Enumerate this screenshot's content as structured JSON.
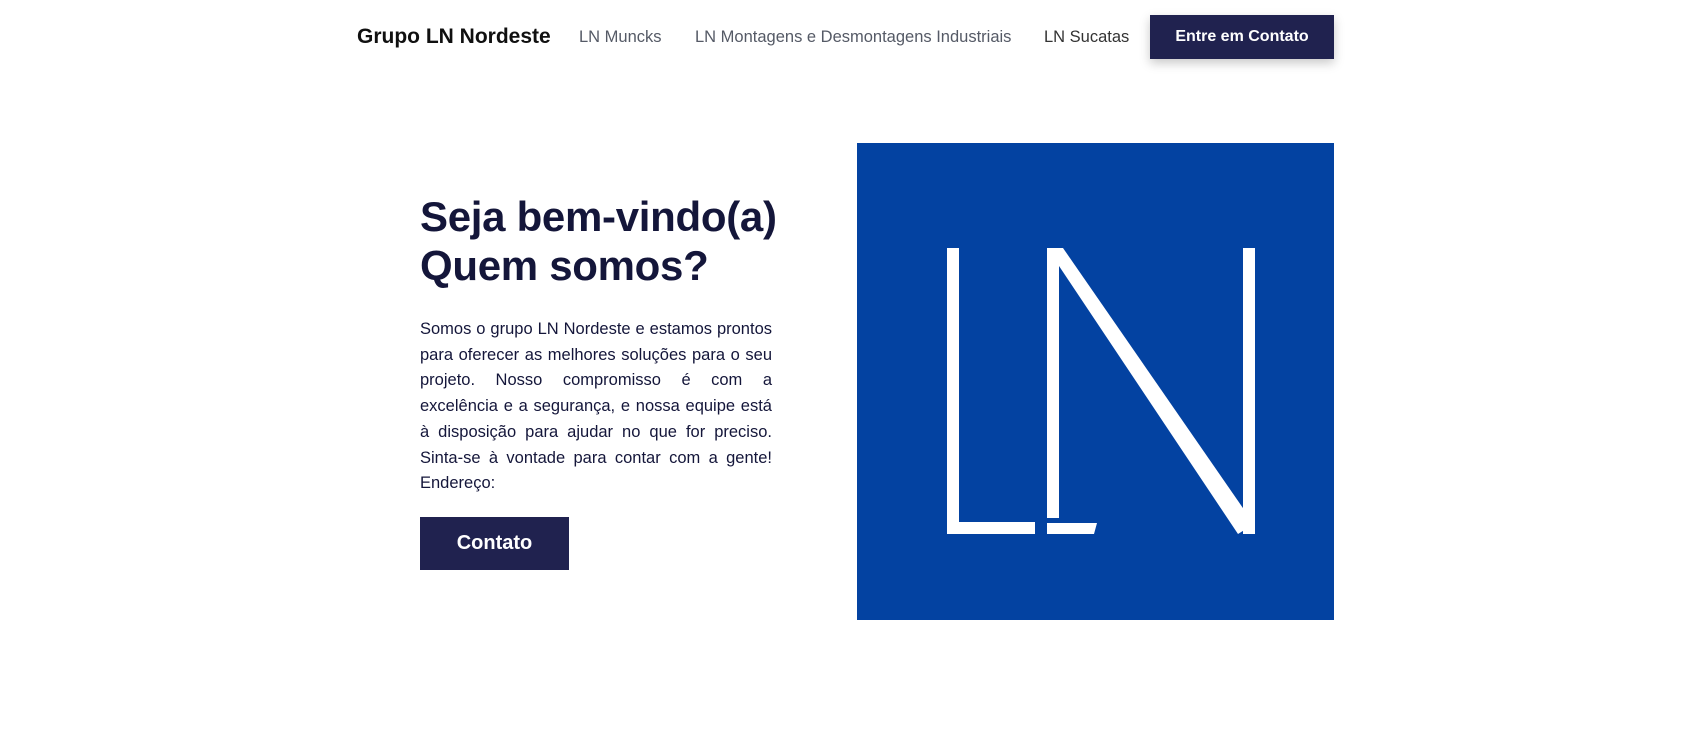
{
  "header": {
    "brand": "Grupo LN Nordeste",
    "nav_links": [
      "LN Muncks",
      "LN Montagens e Desmontagens Industriais",
      "LN Sucatas"
    ],
    "cta_label": "Entre em Contato"
  },
  "hero": {
    "title_line1": "Seja bem-vindo(a)",
    "title_line2": "Quem somos?",
    "body": "Somos o grupo LN Nordeste e estamos prontos para oferecer as melhores soluções para o seu projeto. Nosso compromisso é com a excelência e a segurança, e nossa equipe está à disposição para ajudar no que for preciso. Sinta-se à vontade para contar com a gente! Endereço:",
    "button_label": "Contato"
  },
  "logo": {
    "letters": "LN",
    "background_color": "#0342a1",
    "foreground_color": "#ffffff"
  },
  "colors": {
    "accent": "#20224f",
    "heading": "#14163a"
  }
}
